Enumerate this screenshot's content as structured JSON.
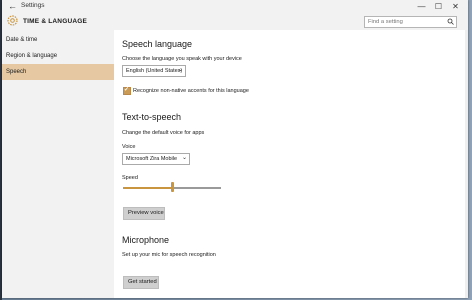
{
  "window": {
    "title": "Settings",
    "back_glyph": "←",
    "controls": {
      "minimize": "—",
      "maximize": "☐",
      "close": "✕"
    }
  },
  "header": {
    "section_title": "TIME & LANGUAGE",
    "search_placeholder": "Find a setting",
    "icon": "gear-icon"
  },
  "sidebar": {
    "items": [
      {
        "label": "Date & time",
        "active": false
      },
      {
        "label": "Region & language",
        "active": false
      },
      {
        "label": "Speech",
        "active": true
      }
    ],
    "accent_color": "#e6c9a3"
  },
  "speech_language": {
    "heading": "Speech language",
    "description": "Choose the language you speak with your device",
    "selected": "English (United States)",
    "checkbox_label": "Recognize non-native accents for this language",
    "checkbox_checked": true
  },
  "text_to_speech": {
    "heading": "Text-to-speech",
    "description": "Change the default voice for apps",
    "voice_label": "Voice",
    "voice_selected": "Microsoft Zira Mobile",
    "speed_label": "Speed",
    "speed_value": 0.5,
    "preview_button": "Preview voice"
  },
  "microphone": {
    "heading": "Microphone",
    "description": "Set up your mic for speech recognition",
    "button": "Get started"
  },
  "colors": {
    "accent": "#c9953f"
  }
}
